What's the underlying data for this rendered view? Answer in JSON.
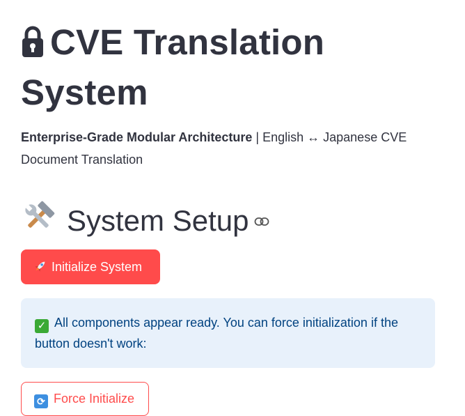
{
  "header": {
    "title": "CVE Translation System",
    "lock_icon": "lock-icon"
  },
  "subtitle": {
    "bold": "Enterprise-Grade Modular Architecture",
    "rest": " | English ↔ Japanese CVE Document Translation"
  },
  "setup": {
    "heading": "System Setup",
    "tools_icon": "hammer-wrench-icon",
    "link_icon": "link-icon",
    "initialize_label": "Initialize System",
    "initialize_icon": "rocket-icon"
  },
  "alert": {
    "icon": "check-mark-icon",
    "text": "All components appear ready. You can force initialization if the button doesn't work:"
  },
  "force": {
    "label": "Force Initialize",
    "icon": "refresh-icon"
  },
  "colors": {
    "primary": "#ff4b4b",
    "text": "#31333f",
    "alert_bg": "#e8f1fb",
    "alert_text": "#004280"
  }
}
